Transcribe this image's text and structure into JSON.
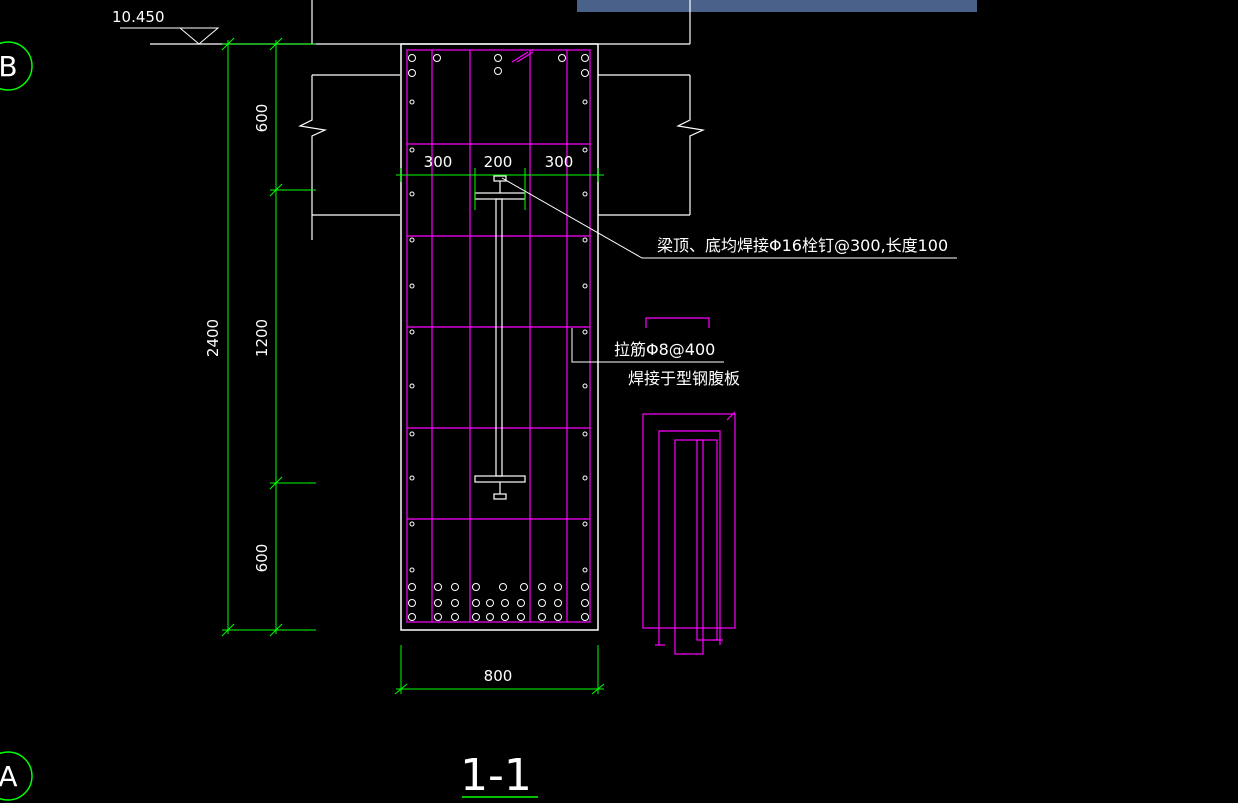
{
  "drawing": {
    "section_label": "1-1",
    "elevation": "10.450",
    "axis_top": "B",
    "axis_bottom": "A",
    "dims_vertical": {
      "overall": "2400",
      "top": "600",
      "middle": "1200",
      "bottom": "600"
    },
    "dims_horizontal": {
      "left": "300",
      "center": "200",
      "right": "300",
      "width": "800"
    },
    "note_studs": "梁顶、底均焊接Φ16栓钉@300,长度100",
    "note_tie_line1": "拉筋Φ8@400",
    "note_tie_line2": "焊接于型钢腹板"
  },
  "colors": {
    "background": "#000000",
    "line_white": "#ffffff",
    "dimension_green": "#00ff00",
    "rebar_magenta": "#ff00ff",
    "titlebar": "#4a6189"
  }
}
